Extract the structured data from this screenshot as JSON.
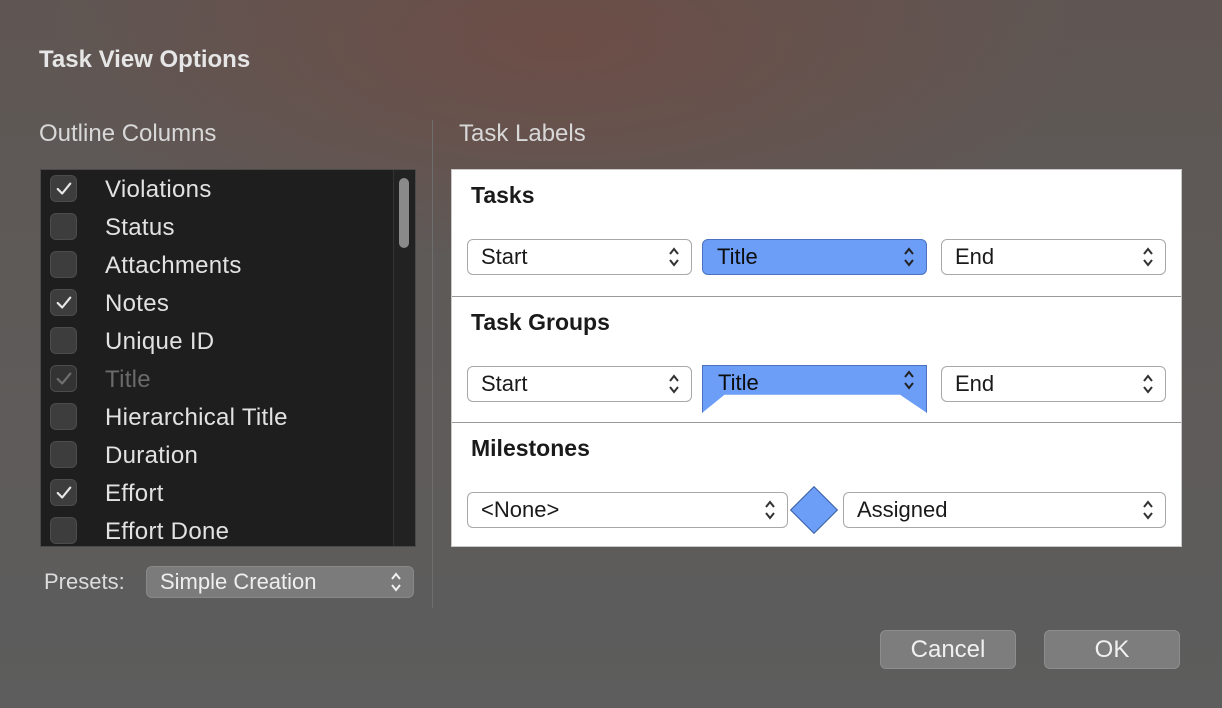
{
  "dialog": {
    "title": "Task View Options"
  },
  "outline_columns": {
    "heading": "Outline Columns",
    "items": [
      {
        "label": "Violations",
        "checked": true,
        "disabled": false
      },
      {
        "label": "Status",
        "checked": false,
        "disabled": false
      },
      {
        "label": "Attachments",
        "checked": false,
        "disabled": false
      },
      {
        "label": "Notes",
        "checked": true,
        "disabled": false
      },
      {
        "label": "Unique ID",
        "checked": false,
        "disabled": false
      },
      {
        "label": "Title",
        "checked": true,
        "disabled": true
      },
      {
        "label": "Hierarchical Title",
        "checked": false,
        "disabled": false
      },
      {
        "label": "Duration",
        "checked": false,
        "disabled": false
      },
      {
        "label": "Effort",
        "checked": true,
        "disabled": false
      },
      {
        "label": "Effort Done",
        "checked": false,
        "disabled": false
      }
    ],
    "presets_label": "Presets:",
    "presets_value": "Simple Creation"
  },
  "task_labels": {
    "heading": "Task Labels",
    "groups": [
      {
        "title": "Tasks",
        "left": "Start",
        "center": "Title",
        "right": "End"
      },
      {
        "title": "Task Groups",
        "left": "Start",
        "center": "Title",
        "right": "End"
      },
      {
        "title": "Milestones",
        "left": "<None>",
        "right": "Assigned"
      }
    ],
    "accent_color": "#6c9ef8"
  },
  "buttons": {
    "cancel": "Cancel",
    "ok": "OK"
  }
}
